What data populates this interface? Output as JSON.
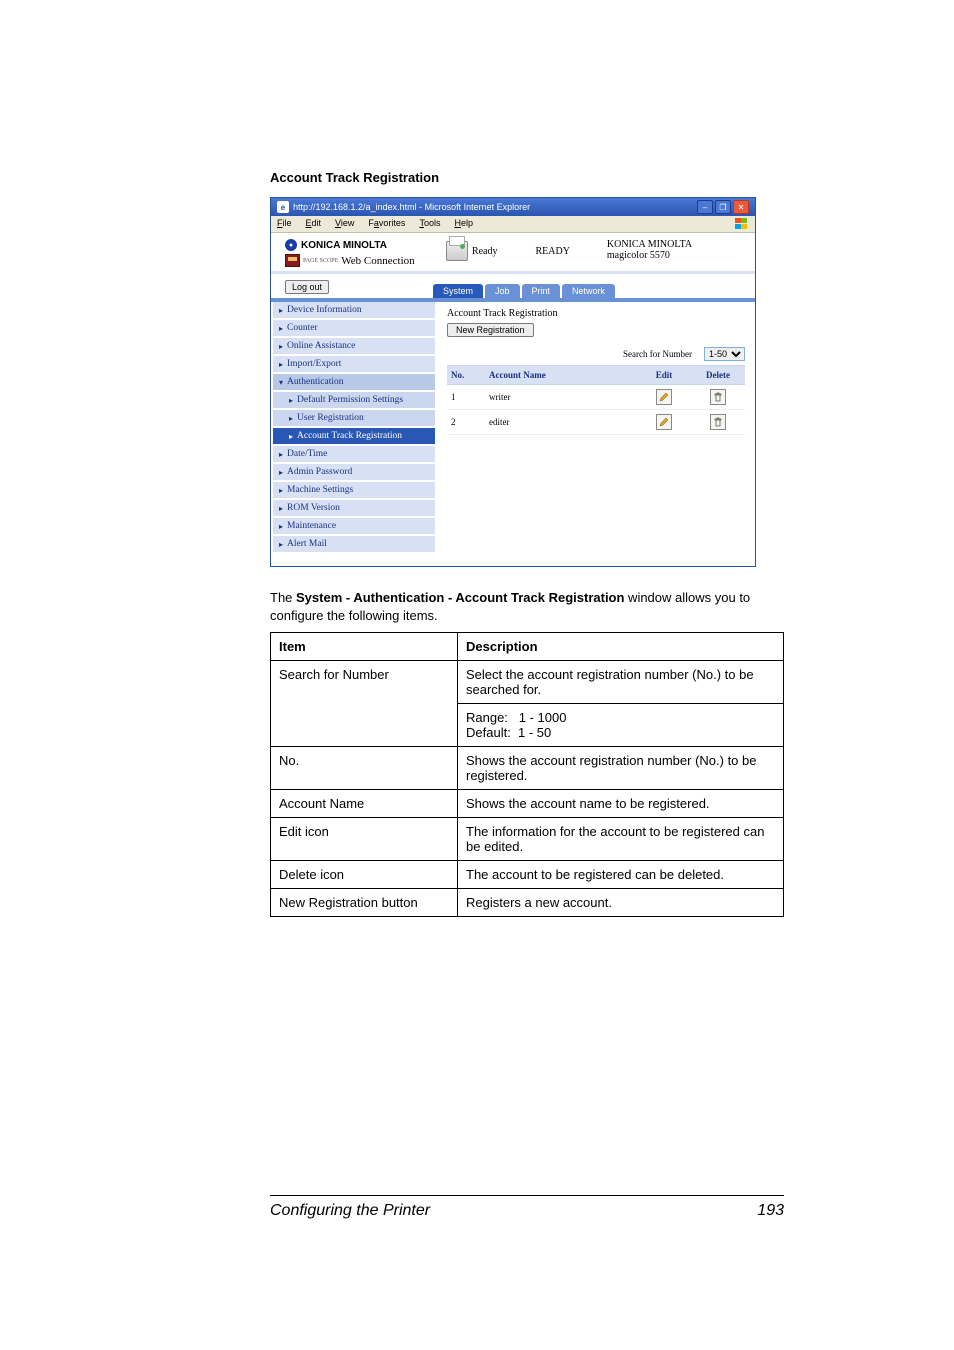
{
  "section_title": "Account Track Registration",
  "ie": {
    "title_url": "http://192.168.1.2/a_index.html - Microsoft Internet Explorer",
    "menus": [
      "File",
      "Edit",
      "View",
      "Favorites",
      "Tools",
      "Help"
    ],
    "brand": "KONICA MINOLTA",
    "pagescope_small": "PAGE SCOPE",
    "pagescope": "Web Connection",
    "ready_small": "Ready",
    "ready_big": "READY",
    "device_brand": "KONICA MINOLTA",
    "device_model": "magicolor 5570",
    "logout": "Log out",
    "tabs": [
      "System",
      "Job",
      "Print",
      "Network"
    ],
    "sidebar": [
      {
        "label": "Device Information",
        "caret": "▸"
      },
      {
        "label": "Counter",
        "caret": "▸"
      },
      {
        "label": "Online Assistance",
        "caret": "▸"
      },
      {
        "label": "Import/Export",
        "caret": "▸"
      },
      {
        "label": "Authentication",
        "caret": "▾",
        "sub": true
      },
      {
        "label": "Default Permission Settings",
        "caret": "▸",
        "sub2": true
      },
      {
        "label": "User Registration",
        "caret": "▸",
        "sub2": true
      },
      {
        "label": "Account Track Registration",
        "caret": "▸",
        "sub2": true,
        "active": true
      },
      {
        "label": "Date/Time",
        "caret": "▸"
      },
      {
        "label": "Admin Password",
        "caret": "▸"
      },
      {
        "label": "Machine Settings",
        "caret": "▸"
      },
      {
        "label": "ROM Version",
        "caret": "▸"
      },
      {
        "label": "Maintenance",
        "caret": "▸"
      },
      {
        "label": "Alert Mail",
        "caret": "▸"
      }
    ],
    "content": {
      "heading": "Account Track Registration",
      "new_reg": "New Registration",
      "search_label": "Search for Number",
      "search_value": "1-50",
      "cols": {
        "no": "No.",
        "name": "Account Name",
        "edit": "Edit",
        "del": "Delete"
      },
      "rows": [
        {
          "no": "1",
          "name": "writer"
        },
        {
          "no": "2",
          "name": "editer"
        }
      ]
    }
  },
  "doc_text_before": "The ",
  "doc_text_bold": "System - Authentication - Account Track Registration",
  "doc_text_after": " window allows you to configure the following items.",
  "table": {
    "head": {
      "item": "Item",
      "desc": "Description"
    },
    "rows": [
      {
        "item": "Search for Number",
        "desc": "Select the account registration number (No.) to be searched for.\n\nRange:   1 - 1000\nDefault:  1 - 50"
      },
      {
        "item": "No.",
        "desc": "Shows the account registration number (No.) to be registered."
      },
      {
        "item": "Account Name",
        "desc": "Shows the account name to be registered."
      },
      {
        "item": "Edit icon",
        "desc": "The information for the account to be registered can be edited."
      },
      {
        "item": "Delete icon",
        "desc": "The account to be registered can be deleted."
      },
      {
        "item": "New Registration button",
        "desc": "Registers a new account."
      }
    ]
  },
  "footer": {
    "left": "Configuring the Printer",
    "right": "193"
  }
}
